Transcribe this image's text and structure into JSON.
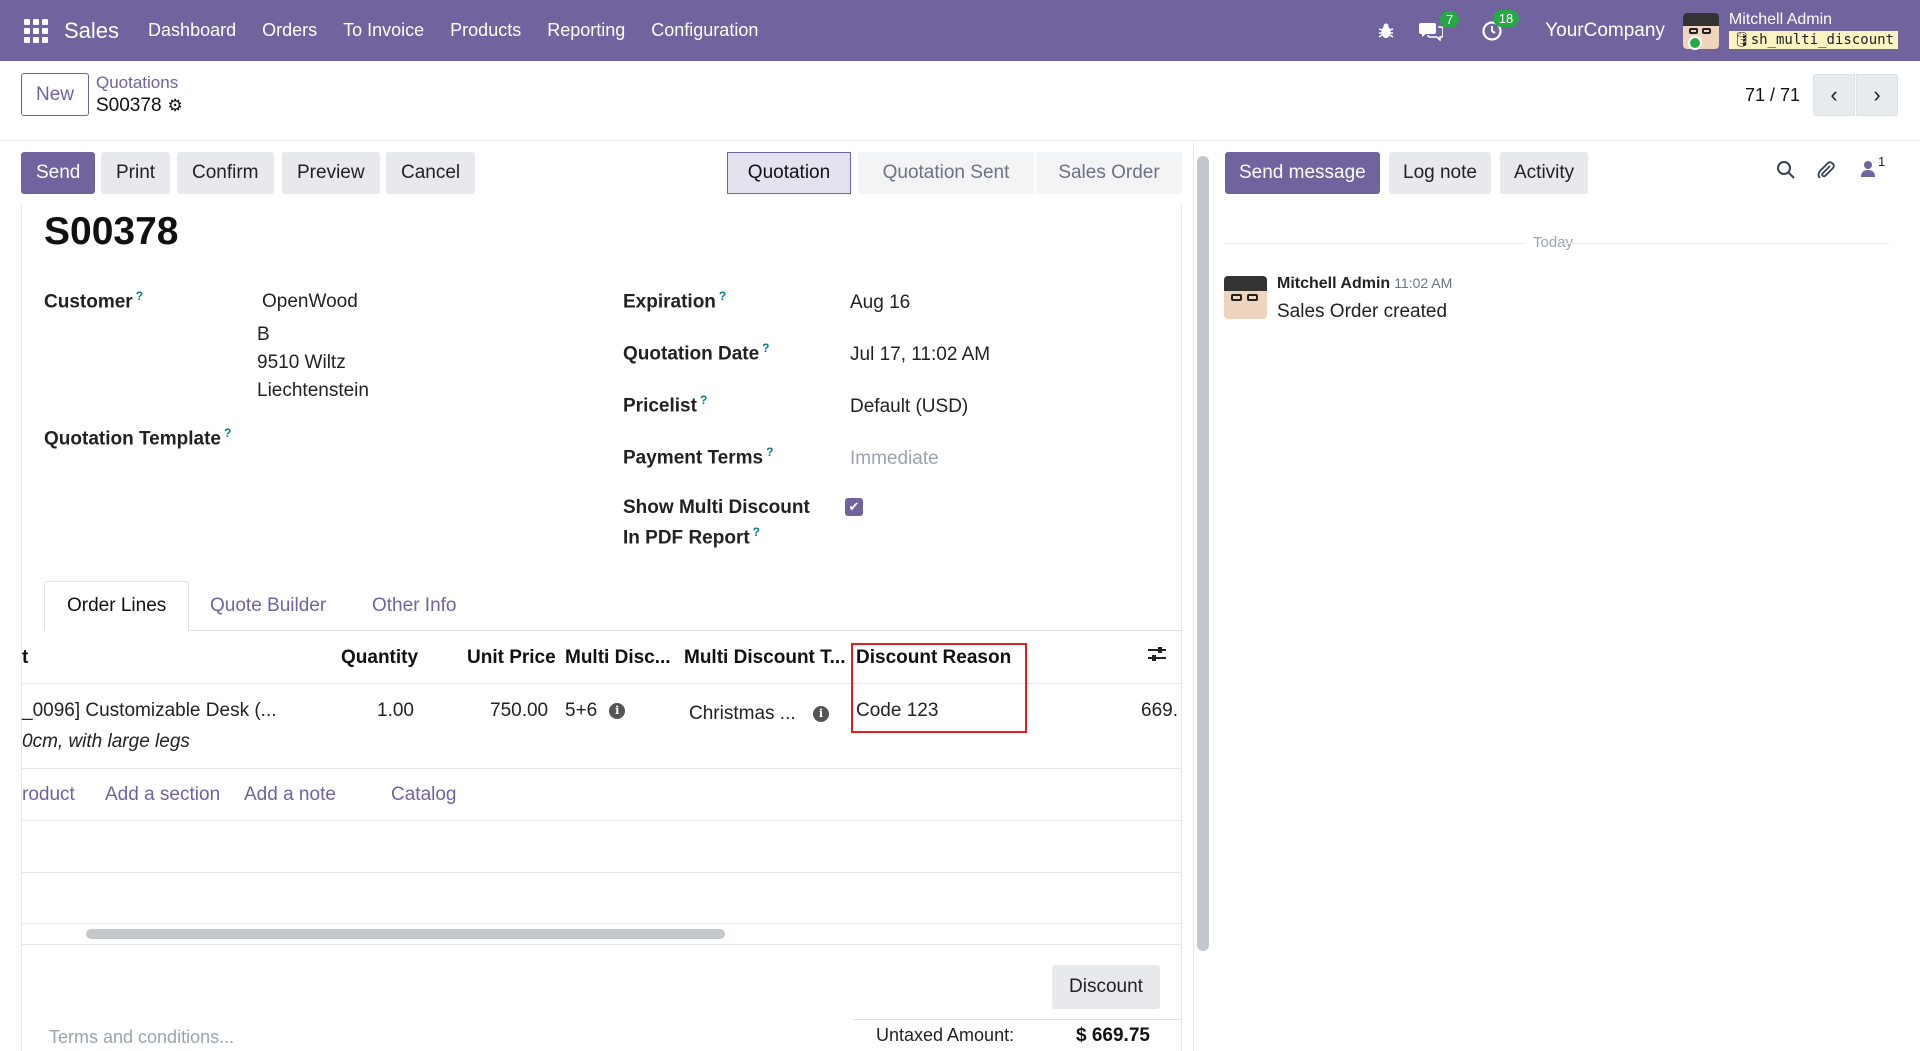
{
  "topnav": {
    "app_name": "Sales",
    "menu": [
      "Dashboard",
      "Orders",
      "To Invoice",
      "Products",
      "Reporting",
      "Configuration"
    ],
    "messages_count": "7",
    "activities_count": "18",
    "company": "YourCompany",
    "user_name": "Mitchell Admin",
    "database": "sh_multi_discount"
  },
  "control": {
    "new_label": "New",
    "breadcrumb_parent": "Quotations",
    "breadcrumb_current": "S00378",
    "pager": "71 / 71"
  },
  "actions": {
    "send": "Send",
    "print": "Print",
    "confirm": "Confirm",
    "preview": "Preview",
    "cancel": "Cancel"
  },
  "statusbar": [
    "Quotation",
    "Quotation Sent",
    "Sales Order"
  ],
  "record": {
    "name": "S00378",
    "customer_label": "Customer",
    "customer_name": "OpenWood",
    "customer_address_1": "B",
    "customer_address_2": "9510 Wiltz",
    "customer_address_3": "Liechtenstein",
    "template_label": "Quotation Template",
    "expiration_label": "Expiration",
    "expiration_value": "Aug 16",
    "quotation_date_label": "Quotation Date",
    "quotation_date_value": "Jul 17, 11:02 AM",
    "pricelist_label": "Pricelist",
    "pricelist_value": "Default (USD)",
    "payment_terms_label": "Payment Terms",
    "payment_terms_placeholder": "Immediate",
    "multi_discount_label_1": "Show Multi Discount",
    "multi_discount_label_2": "In PDF Report",
    "multi_discount_checked": true,
    "help_mark": "?"
  },
  "tabs": [
    "Order Lines",
    "Quote Builder",
    "Other Info"
  ],
  "order_lines": {
    "headers": {
      "product": "t",
      "quantity": "Quantity",
      "unit_price": "Unit Price",
      "multi_disc": "Multi Disc...",
      "multi_disc_type": "Multi Discount T...",
      "discount_reason": "Discount Reason"
    },
    "rows": [
      {
        "product": "_0096] Customizable Desk (...",
        "description": "0cm, with large legs",
        "quantity": "1.00",
        "unit_price": "750.00",
        "multi_disc": "5+6",
        "multi_disc_type": "Christmas ...",
        "discount_reason": "Code 123",
        "subtotal": "669."
      }
    ],
    "add_product": "roduct",
    "add_section": "Add a section",
    "add_note": "Add a note",
    "catalog": "Catalog"
  },
  "footer": {
    "discount_button": "Discount",
    "terms_placeholder": "Terms and conditions...",
    "untaxed_label": "Untaxed Amount:",
    "untaxed_value": "$ 669.75"
  },
  "chatter": {
    "send_message": "Send message",
    "log_note": "Log note",
    "activity": "Activity",
    "followers_count": "1",
    "today": "Today",
    "message_author": "Mitchell Admin",
    "message_time": "11:02 AM",
    "message_body": "Sales Order created"
  },
  "colors": {
    "brand": "#71639e",
    "highlight": "#e02020",
    "badge": "#28a745"
  }
}
